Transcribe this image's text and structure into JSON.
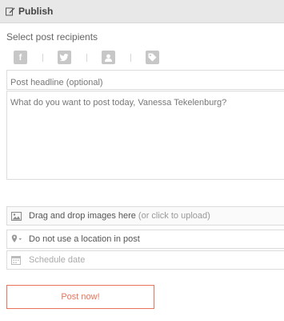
{
  "header": {
    "title": "Publish",
    "icon": "edit-icon"
  },
  "recipients": {
    "label": "Select post recipients",
    "networks": [
      {
        "name": "facebook",
        "glyph": "f"
      },
      {
        "name": "twitter",
        "glyph": ""
      },
      {
        "name": "user",
        "glyph": ""
      },
      {
        "name": "tag",
        "glyph": ""
      }
    ]
  },
  "form": {
    "headline_placeholder": "Post headline (optional)",
    "message_placeholder": "What do you want to post today, Vanessa Tekelenburg?",
    "upload_label": "Drag and drop images here",
    "upload_hint": "(or click to upload)",
    "location_label": "Do not use a location in  post",
    "schedule_placeholder": "Schedule date"
  },
  "actions": {
    "post_label": "Post now!"
  },
  "colors": {
    "accent": "#e8735a",
    "header_bg": "#e8e8e8",
    "icon_gray": "#c7c7c7"
  }
}
